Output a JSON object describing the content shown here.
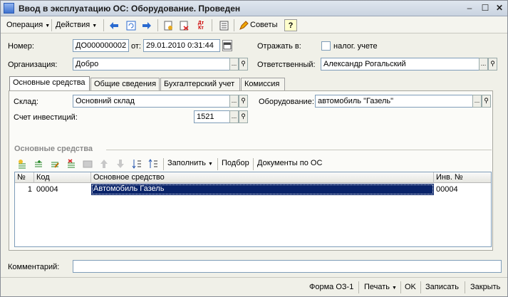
{
  "window": {
    "title": "Ввод в эксплуатацию ОС: Оборудование. Проведен"
  },
  "toolbar": {
    "operation_label": "Операция",
    "actions_label": "Действия",
    "advice_label": "Советы",
    "help_label": "?",
    "dtkt_top": "Дт",
    "dtkt_bottom": "Кт"
  },
  "header": {
    "number_label": "Номер:",
    "number_value": "ДО000000002",
    "date_label": "от:",
    "date_value": "29.01.2010 0:31:44",
    "reflect_label": "Отражать в:",
    "tax_label": "налог. учете",
    "tax_checked": false,
    "org_label": "Организация:",
    "org_value": "Добро",
    "responsible_label": "Ответственный:",
    "responsible_value": "Александр Рогальский"
  },
  "tabs": [
    {
      "label": "Основные средства",
      "active": true
    },
    {
      "label": "Общие сведения",
      "active": false
    },
    {
      "label": "Бухгалтерский учет",
      "active": false
    },
    {
      "label": "Комиссия",
      "active": false
    }
  ],
  "main": {
    "warehouse_label": "Склад:",
    "warehouse_value": "Основний склад",
    "equipment_label": "Оборудование:",
    "equipment_value": "автомобиль \"Газель\"",
    "invest_label": "Счет инвестиций:",
    "invest_value": "1521",
    "section_title": "Основные средства",
    "fill_label": "Заполнить",
    "pick_label": "Подбор",
    "docs_label": "Документы по ОС"
  },
  "table": {
    "columns": [
      "№",
      "Код",
      "Основное средство",
      "Инв. №"
    ],
    "rows": [
      {
        "n": "1",
        "code": "00004",
        "asset": "Автомобиль Газель",
        "inv": "00004"
      }
    ]
  },
  "footer": {
    "comment_label": "Комментарий:",
    "comment_value": "",
    "form_label": "Форма ОЗ-1",
    "print_label": "Печать",
    "ok_label": "OK",
    "save_label": "Записать",
    "close_label": "Закрыть"
  },
  "colors": {
    "selection": "#0a246a",
    "accent": "#316ac5"
  }
}
